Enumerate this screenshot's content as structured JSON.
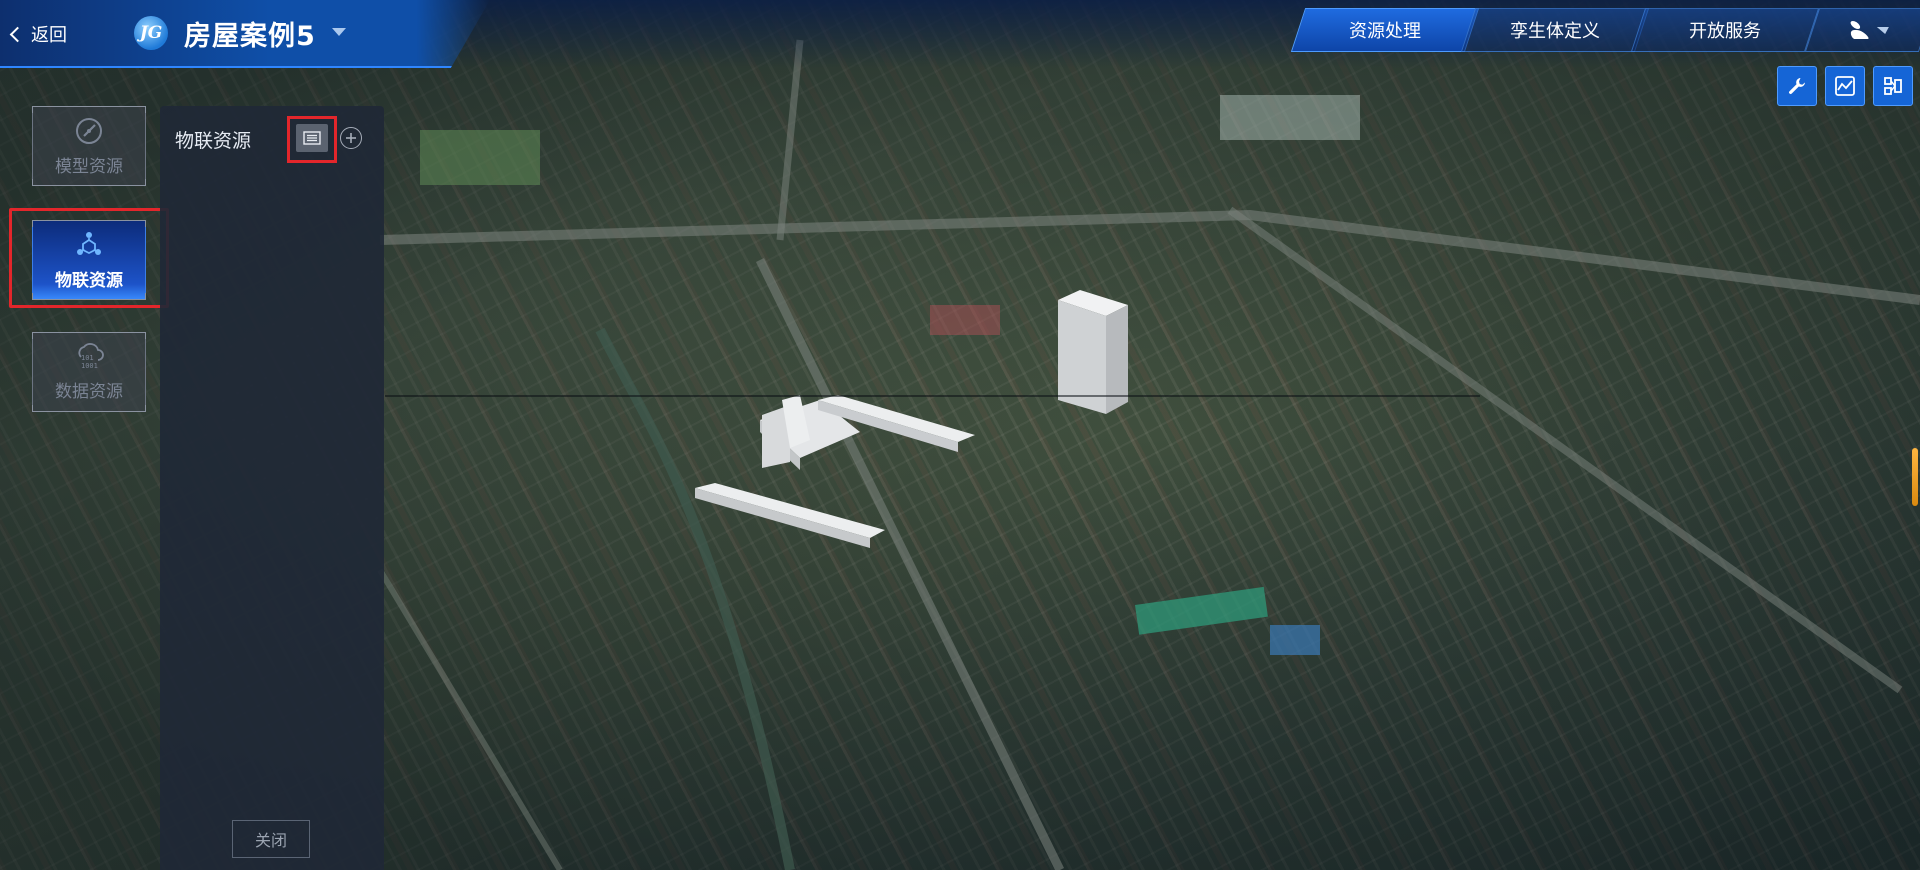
{
  "header": {
    "back_label": "返回",
    "logo_text": "JG",
    "project_title": "房屋案例5",
    "tabs": [
      {
        "label": "资源处理",
        "active": true
      },
      {
        "label": "孪生体定义",
        "active": false
      },
      {
        "label": "开放服务",
        "active": false
      }
    ],
    "user_icon": "user-icon"
  },
  "toolbar": {
    "icons": [
      "wrench-icon",
      "line-chart-icon",
      "layout-icon"
    ],
    "accent": "#1565d6"
  },
  "sidebar": {
    "items": [
      {
        "label": "模型资源",
        "icon": "compass-icon",
        "active": false
      },
      {
        "label": "物联资源",
        "icon": "iot-nodes-icon",
        "active": true
      },
      {
        "label": "数据资源",
        "icon": "binary-cloud-icon",
        "active": false
      }
    ]
  },
  "panel": {
    "title": "物联资源",
    "list_view_icon": "list-view-icon",
    "add_icon": "plus-circle-icon",
    "close_label": "关闭"
  },
  "colors": {
    "highlight": "#e3262b",
    "panel_bg": "#202836",
    "active_nav": "#1f6be0"
  }
}
